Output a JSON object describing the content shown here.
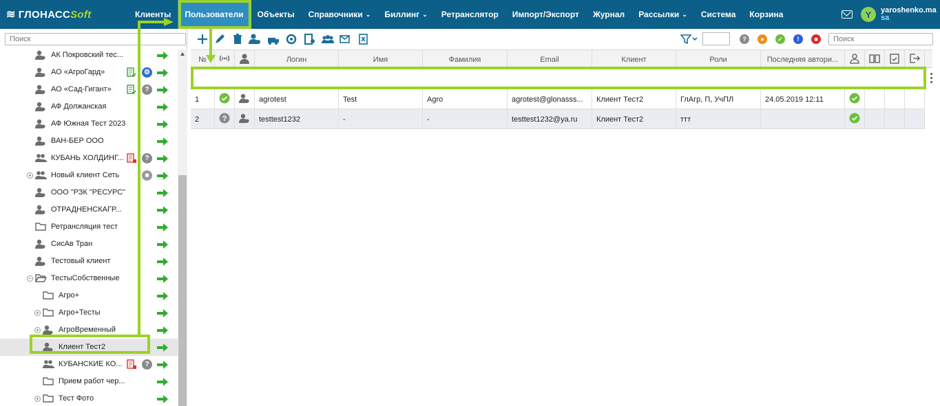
{
  "app": {
    "logo_main": "ГЛОНАСС",
    "logo_soft": "Soft"
  },
  "nav": [
    {
      "label": "Клиенты",
      "active": false,
      "caret": false
    },
    {
      "label": "Пользователи",
      "active": true,
      "caret": false
    },
    {
      "label": "Объекты",
      "active": false,
      "caret": false
    },
    {
      "label": "Справочники",
      "active": false,
      "caret": true
    },
    {
      "label": "Биллинг",
      "active": false,
      "caret": true
    },
    {
      "label": "Ретранслятор",
      "active": false,
      "caret": false
    },
    {
      "label": "Импорт/Экспорт",
      "active": false,
      "caret": false
    },
    {
      "label": "Журнал",
      "active": false,
      "caret": false
    },
    {
      "label": "Рассылки",
      "active": false,
      "caret": true
    },
    {
      "label": "Система",
      "active": false,
      "caret": false
    },
    {
      "label": "Корзина",
      "active": false,
      "caret": false
    }
  ],
  "user": {
    "avatar_letter": "Y",
    "name": "yaroshenko.ma",
    "role": "sa"
  },
  "left_panel": {
    "search_placeholder": "Поиск",
    "items": [
      {
        "label": "АК Покровский тес...",
        "icon": "user-icon",
        "expander": "",
        "doc": false,
        "badge": ""
      },
      {
        "label": "АО «АгроГард»",
        "icon": "user-icon",
        "expander": "",
        "doc": "green",
        "badge": "gear"
      },
      {
        "label": "АО «Сад-Гигант»",
        "icon": "user-icon",
        "expander": "",
        "doc": "green",
        "badge": "question"
      },
      {
        "label": "АФ Должанская",
        "icon": "user-icon",
        "expander": "",
        "doc": false,
        "badge": ""
      },
      {
        "label": "АФ Южная Тест 2023",
        "icon": "user-icon",
        "expander": "",
        "doc": false,
        "badge": ""
      },
      {
        "label": "ВАН-БЕР ООО",
        "icon": "user-icon",
        "expander": "",
        "doc": false,
        "badge": ""
      },
      {
        "label": "КУБАНЬ ХОЛДИНГ...",
        "icon": "users-icon",
        "expander": "",
        "doc": "red",
        "badge": "question"
      },
      {
        "label": "Новый клиент Сеть",
        "icon": "users-icon",
        "expander": "+",
        "doc": false,
        "badge": "lock"
      },
      {
        "label": "ООО \"РЗК \"РЕСУРС\"",
        "icon": "user-icon",
        "expander": "",
        "doc": false,
        "badge": ""
      },
      {
        "label": "ОТРАДНЕНСКАГР...",
        "icon": "user-icon",
        "expander": "",
        "doc": false,
        "badge": ""
      },
      {
        "label": "Ретрансляция тест",
        "icon": "folder-icon",
        "expander": "",
        "doc": false,
        "badge": ""
      },
      {
        "label": "СисАв Тран",
        "icon": "user-icon",
        "expander": "",
        "doc": false,
        "badge": ""
      },
      {
        "label": "Тестовый клиент",
        "icon": "user-icon",
        "expander": "",
        "doc": false,
        "badge": ""
      },
      {
        "label": "ТестыСобственные",
        "icon": "folder-open-icon",
        "expander": "−",
        "doc": false,
        "badge": ""
      },
      {
        "label": "Агро+",
        "icon": "folder-icon",
        "expander": "",
        "doc": false,
        "badge": "",
        "child": true
      },
      {
        "label": "Агро+Тесты",
        "icon": "folder-icon",
        "expander": "+",
        "doc": false,
        "badge": "",
        "child": true
      },
      {
        "label": "АгроВременный",
        "icon": "user-icon",
        "expander": "+",
        "doc": false,
        "badge": "",
        "child": true
      },
      {
        "label": "Клиент Тест2",
        "icon": "user-icon",
        "expander": "",
        "doc": false,
        "badge": "",
        "child": true,
        "selected": true
      },
      {
        "label": "КУБАНСКИЕ КО...",
        "icon": "users-icon",
        "expander": "",
        "doc": "red",
        "badge": "question",
        "child": true
      },
      {
        "label": "Прием работ чер...",
        "icon": "folder-icon",
        "expander": "",
        "doc": false,
        "badge": "",
        "child": true
      },
      {
        "label": "Тест Фото",
        "icon": "folder-icon",
        "expander": "+",
        "doc": false,
        "badge": "",
        "child": true
      }
    ]
  },
  "toolbar": {
    "search_placeholder": "Поиск"
  },
  "grid": {
    "columns": [
      "№",
      "",
      "",
      "Логин",
      "Имя",
      "Фамилия",
      "Email",
      "Клиент",
      "Роли",
      "Последняя автори...",
      "",
      "",
      "",
      ""
    ],
    "rows": [
      {
        "num": "1",
        "status": "ok",
        "login": "agrotest",
        "first_name": "Test",
        "last_name": "Agro",
        "email": "agrotest@glonasss...",
        "client": "Клиент Тест2",
        "roles": "ГлАгр, П, УчПЛ",
        "last_auth": "24.05.2019 12:11",
        "active": "ok"
      },
      {
        "num": "2",
        "status": "unknown",
        "login": "testtest1232",
        "first_name": "-",
        "last_name": "-",
        "email": "testtest1232@ya.ru",
        "client": "Клиент Тест2",
        "roles": "ттт",
        "last_auth": "",
        "active": "ok"
      }
    ]
  },
  "colors": {
    "topbar": "#0b5f88",
    "active_tab": "#2f8dbf",
    "highlight": "#9bd22a",
    "go_arrow": "#2eae2e",
    "ok_green": "#6dbf3a",
    "question_gray": "#8a8a8a",
    "badge_blue": "#2e6fd8",
    "lock_gray": "#9a9a9a",
    "status_orange": "#f08c1d",
    "status_blue": "#2e5fd8",
    "status_red": "#dd2a2a"
  }
}
